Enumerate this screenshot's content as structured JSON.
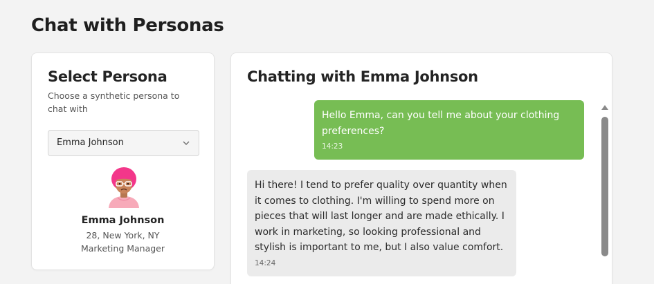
{
  "page": {
    "title": "Chat with Personas"
  },
  "persona_panel": {
    "title": "Select Persona",
    "subtitle": "Choose a synthetic persona to chat with",
    "select": {
      "selected": "Emma Johnson"
    },
    "persona": {
      "name": "Emma Johnson",
      "location": "28, New York, NY",
      "occupation": "Marketing Manager"
    }
  },
  "chat": {
    "title": "Chatting with Emma Johnson",
    "messages": [
      {
        "role": "user",
        "text": "Hello Emma, can you tell me about your clothing preferences?",
        "time": "14:23"
      },
      {
        "role": "persona",
        "text": "Hi there! I tend to prefer quality over quantity when it comes to clothing. I'm willing to spend more on pieces that will last longer and are made ethically. I work in marketing, so looking professional and stylish is important to me, but I also value comfort.",
        "time": "14:24"
      }
    ]
  },
  "colors": {
    "user_bubble": "#77bd54",
    "persona_bubble": "#ebebeb",
    "background": "#f3f3f3"
  },
  "icons": {
    "dropdown": "chevron-down-icon",
    "avatar": "persona-avatar",
    "scroll_up": "scroll-up-arrow-icon"
  }
}
